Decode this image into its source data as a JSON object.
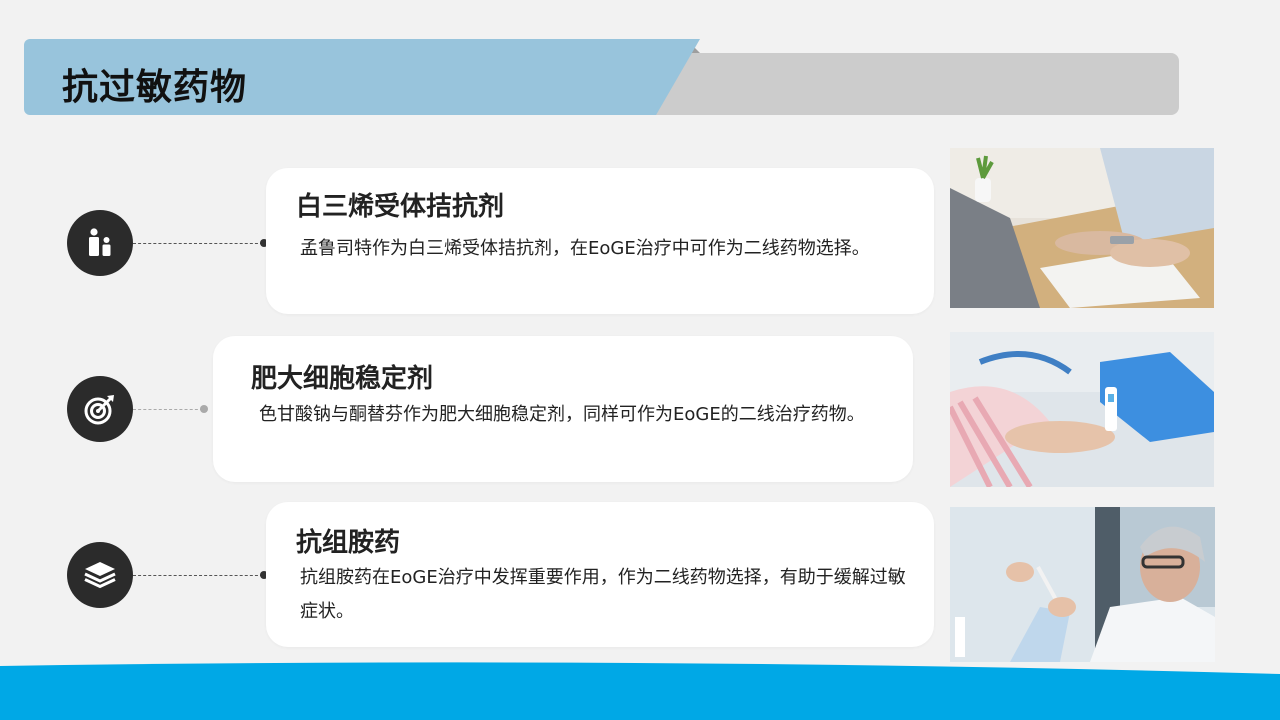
{
  "header": {
    "title": "抗过敏药物"
  },
  "items": [
    {
      "title": "白三烯受体拮抗剂",
      "text": "孟鲁司特作为白三烯受体拮抗剂，在EoGE治疗中可作为二线药物选择。",
      "icon": "people-icon"
    },
    {
      "title": "肥大细胞稳定剂",
      "text": "色甘酸钠与酮替芬作为肥大细胞稳定剂，同样可作为EoGE的二线治疗药物。",
      "icon": "target-icon"
    },
    {
      "title": "抗组胺药",
      "text": "抗组胺药在EoGE治疗中发挥重要作用，作为二线药物选择，有助于缓解过敏症状。",
      "icon": "layers-icon"
    }
  ],
  "colors": {
    "header_accent": "#98c4dc",
    "header_bar": "#cccccc",
    "icon_circle": "#2b2b2b",
    "footer_wave": "#00a8e6"
  }
}
